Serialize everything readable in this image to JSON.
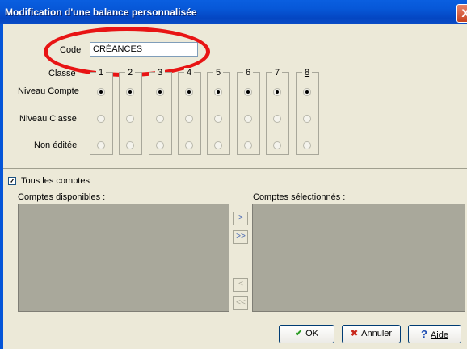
{
  "window": {
    "title": "Modification d'une balance personnalisée",
    "close_glyph": "X"
  },
  "code": {
    "label": "Code",
    "value": "CRÉANCES"
  },
  "grid": {
    "classe_label": "Classe",
    "columns": [
      "1",
      "2",
      "3",
      "4",
      "5",
      "6",
      "7",
      "8"
    ],
    "rows": [
      {
        "label": "Niveau Compte",
        "selected": true
      },
      {
        "label": "Niveau Classe",
        "selected": false
      },
      {
        "label": "Non éditée",
        "selected": false
      }
    ]
  },
  "tous_les_comptes": {
    "label": "Tous les comptes",
    "checked": true,
    "check_glyph": "✓"
  },
  "lists": {
    "available_label": "Comptes disponibles :",
    "selected_label": "Comptes sélectionnés :"
  },
  "move_buttons": [
    ">",
    ">>",
    "<",
    "<<"
  ],
  "buttons": {
    "ok": {
      "label": "OK",
      "icon": "checkmark-icon",
      "glyph": "✔"
    },
    "cancel": {
      "label": "Annuler",
      "icon": "x-icon",
      "glyph": "✖"
    },
    "help": {
      "label": "Aide",
      "icon": "question-icon",
      "glyph": "?"
    }
  },
  "colors": {
    "titlebar": "#0a5fe0",
    "annotation": "#e81414",
    "list_bg": "#a9a89b"
  }
}
